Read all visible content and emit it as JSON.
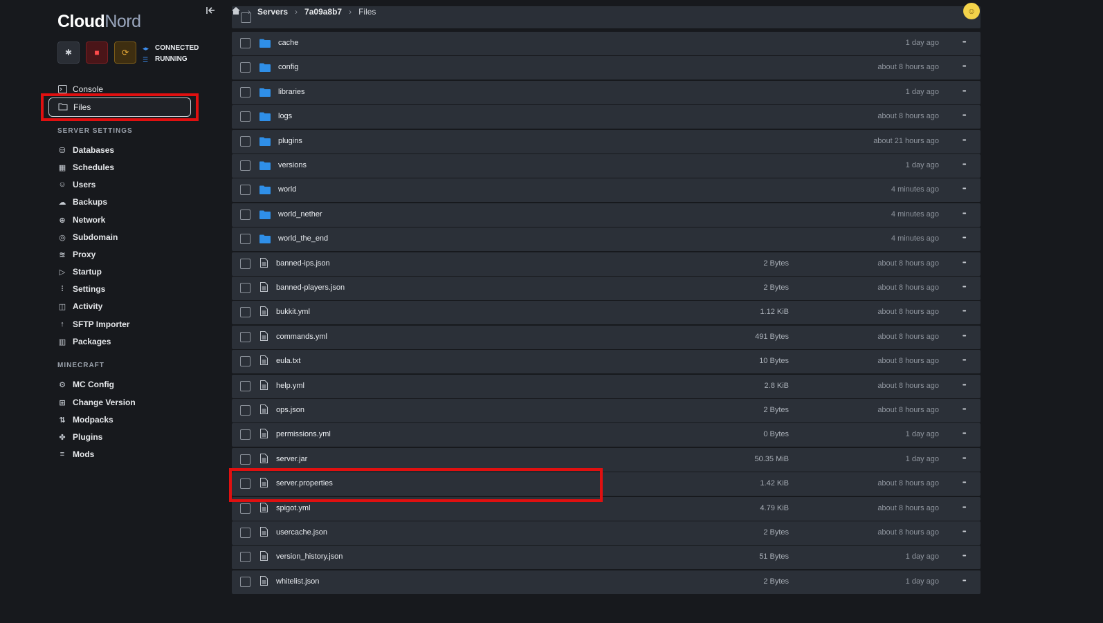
{
  "brand": {
    "part1": "Cloud",
    "part2": "Nord"
  },
  "status": {
    "connection": "CONNECTED",
    "state": "RUNNING"
  },
  "nav_top": [
    {
      "label": "Console",
      "icon": "terminal-icon"
    },
    {
      "label": "Files",
      "icon": "folder-icon"
    }
  ],
  "server_settings": {
    "title": "SERVER SETTINGS",
    "items": [
      {
        "label": "Databases",
        "icon": "database-icon"
      },
      {
        "label": "Schedules",
        "icon": "calendar-icon"
      },
      {
        "label": "Users",
        "icon": "users-icon"
      },
      {
        "label": "Backups",
        "icon": "cloud-upload-icon"
      },
      {
        "label": "Network",
        "icon": "globe-icon"
      },
      {
        "label": "Subdomain",
        "icon": "globe-alt-icon"
      },
      {
        "label": "Proxy",
        "icon": "wifi-icon"
      },
      {
        "label": "Startup",
        "icon": "play-icon"
      },
      {
        "label": "Settings",
        "icon": "sliders-icon"
      },
      {
        "label": "Activity",
        "icon": "activity-icon"
      },
      {
        "label": "SFTP Importer",
        "icon": "arrow-up-icon"
      },
      {
        "label": "Packages",
        "icon": "chart-icon"
      }
    ]
  },
  "minecraft": {
    "title": "MINECRAFT",
    "items": [
      {
        "label": "MC Config",
        "icon": "gear-icon"
      },
      {
        "label": "Change Version",
        "icon": "grid-icon"
      },
      {
        "label": "Modpacks",
        "icon": "arrows-icon"
      },
      {
        "label": "Plugins",
        "icon": "puzzle-icon"
      },
      {
        "label": "Mods",
        "icon": "list-icon"
      }
    ]
  },
  "breadcrumb": {
    "servers": "Servers",
    "server_id": "7a09a8b7",
    "current": "Files"
  },
  "files": [
    {
      "name": "cache",
      "type": "folder",
      "size": "",
      "modified": "1 day ago"
    },
    {
      "name": "config",
      "type": "folder",
      "size": "",
      "modified": "about 8 hours ago"
    },
    {
      "name": "libraries",
      "type": "folder",
      "size": "",
      "modified": "1 day ago"
    },
    {
      "name": "logs",
      "type": "folder",
      "size": "",
      "modified": "about 8 hours ago"
    },
    {
      "name": "plugins",
      "type": "folder",
      "size": "",
      "modified": "about 21 hours ago"
    },
    {
      "name": "versions",
      "type": "folder",
      "size": "",
      "modified": "1 day ago"
    },
    {
      "name": "world",
      "type": "folder",
      "size": "",
      "modified": "4 minutes ago"
    },
    {
      "name": "world_nether",
      "type": "folder",
      "size": "",
      "modified": "4 minutes ago"
    },
    {
      "name": "world_the_end",
      "type": "folder",
      "size": "",
      "modified": "4 minutes ago"
    },
    {
      "name": "banned-ips.json",
      "type": "file",
      "size": "2 Bytes",
      "modified": "about 8 hours ago"
    },
    {
      "name": "banned-players.json",
      "type": "file",
      "size": "2 Bytes",
      "modified": "about 8 hours ago"
    },
    {
      "name": "bukkit.yml",
      "type": "file",
      "size": "1.12 KiB",
      "modified": "about 8 hours ago"
    },
    {
      "name": "commands.yml",
      "type": "file",
      "size": "491 Bytes",
      "modified": "about 8 hours ago"
    },
    {
      "name": "eula.txt",
      "type": "file",
      "size": "10 Bytes",
      "modified": "about 8 hours ago"
    },
    {
      "name": "help.yml",
      "type": "file",
      "size": "2.8 KiB",
      "modified": "about 8 hours ago"
    },
    {
      "name": "ops.json",
      "type": "file",
      "size": "2 Bytes",
      "modified": "about 8 hours ago"
    },
    {
      "name": "permissions.yml",
      "type": "file",
      "size": "0 Bytes",
      "modified": "1 day ago"
    },
    {
      "name": "server.jar",
      "type": "file",
      "size": "50.35 MiB",
      "modified": "1 day ago"
    },
    {
      "name": "server.properties",
      "type": "file",
      "size": "1.42 KiB",
      "modified": "about 8 hours ago"
    },
    {
      "name": "spigot.yml",
      "type": "file",
      "size": "4.79 KiB",
      "modified": "about 8 hours ago"
    },
    {
      "name": "usercache.json",
      "type": "file",
      "size": "2 Bytes",
      "modified": "about 8 hours ago"
    },
    {
      "name": "version_history.json",
      "type": "file",
      "size": "51 Bytes",
      "modified": "1 day ago"
    },
    {
      "name": "whitelist.json",
      "type": "file",
      "size": "2 Bytes",
      "modified": "1 day ago"
    }
  ],
  "colors": {
    "highlight": "#e01010",
    "folder": "#2f8fe8",
    "background": "#17191d",
    "row": "#2b3038"
  }
}
